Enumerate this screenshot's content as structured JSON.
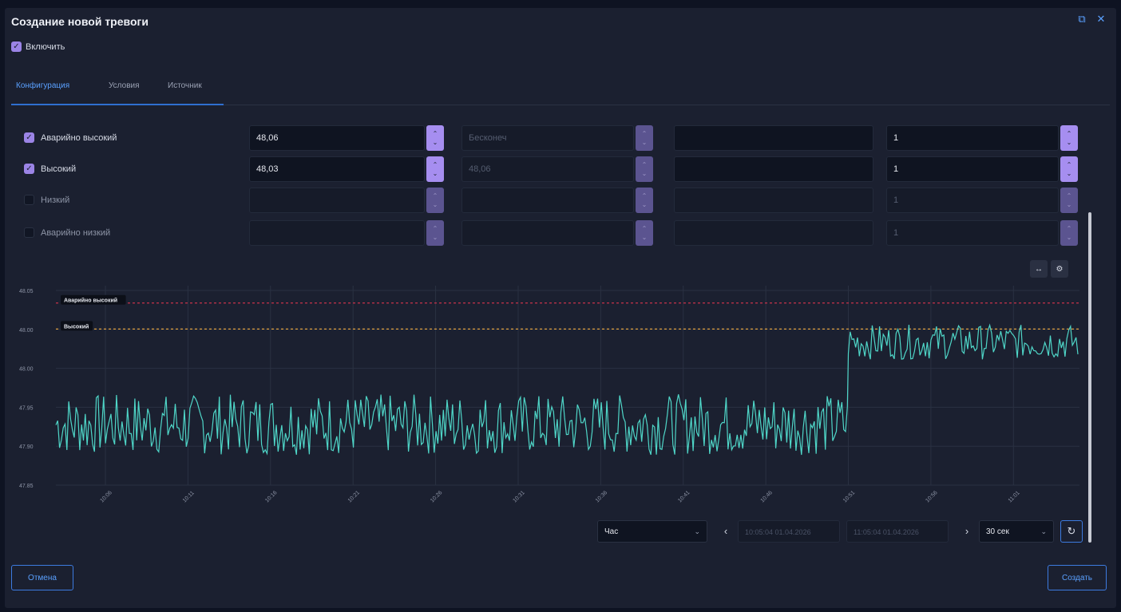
{
  "dialog": {
    "title": "Создание новой тревоги"
  },
  "header_icons": [
    "external-link-icon",
    "close-icon"
  ],
  "enable": {
    "label": "Включить",
    "checked": true
  },
  "tabs": [
    {
      "label": "Конфигурация",
      "active": true
    },
    {
      "label": "Условия",
      "active": false
    },
    {
      "label": "Источник",
      "active": false
    }
  ],
  "thresholds": [
    {
      "label": "Аварийно высокий",
      "enabled": true,
      "value": "48,06",
      "limit": "Бесконеч",
      "text": "",
      "delay": "1"
    },
    {
      "label": "Высокий",
      "enabled": true,
      "value": "48,03",
      "limit": "48,06",
      "text": "",
      "delay": "1"
    },
    {
      "label": "Низкий",
      "enabled": false,
      "value": "",
      "limit": "",
      "text": "",
      "delay": "1"
    },
    {
      "label": "Аварийно низкий",
      "enabled": false,
      "value": "",
      "limit": "",
      "text": "",
      "delay": "1"
    }
  ],
  "chart_tools": [
    "expand-horizontal-icon",
    "settings-icon"
  ],
  "chart_data": {
    "type": "line",
    "y_ticks": [
      "48.05",
      "48.00",
      "48.00",
      "47.95",
      "47.90",
      "47.85"
    ],
    "ylim": [
      47.85,
      48.08
    ],
    "x_ticks": [
      "10:06",
      "10:11",
      "10:16",
      "10:21",
      "10:26",
      "10:31",
      "10:36",
      "10:41",
      "10:46",
      "10:51",
      "10:56",
      "11:01"
    ],
    "threshold_lines": [
      {
        "name": "Аварийно высокий",
        "value": 48.06,
        "color": "#c8324a"
      },
      {
        "name": "Высокий",
        "value": 48.03,
        "color": "#e0a040"
      }
    ],
    "series": [
      {
        "color": "#4fd6c8",
        "segments": [
          {
            "from": "10:03",
            "to": "10:51",
            "base": 47.92,
            "amplitude": 0.035
          },
          {
            "from": "10:51",
            "to": "11:05",
            "base": 48.015,
            "amplitude": 0.02
          }
        ]
      }
    ],
    "grid": true
  },
  "footer": {
    "period": "Час",
    "from": "10:05:04 01.04.2026",
    "to": "11:05:04 01.04.2026",
    "interval": "30 сек",
    "cancel": "Отмена",
    "create": "Создать"
  }
}
